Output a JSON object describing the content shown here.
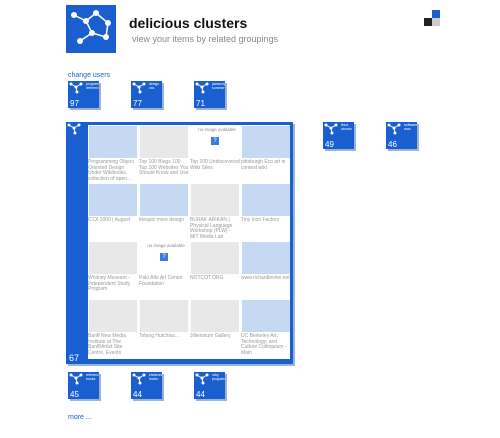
{
  "header": {
    "title": "delicious clusters",
    "subtitle": "view your items by related groupings"
  },
  "links": {
    "change_users": "change users",
    "more": "more ..."
  },
  "top_clusters": [
    {
      "label": "program reference",
      "count": "97"
    },
    {
      "label": "design css",
      "count": "77"
    },
    {
      "label": "javascript summer",
      "count": "71"
    }
  ],
  "side_clusters": [
    {
      "label": "linux ubuntu",
      "count": "49"
    },
    {
      "label": "software mac",
      "count": "46"
    }
  ],
  "bottom_clusters": [
    {
      "label": "reference books",
      "count": "45"
    },
    {
      "label": "electronics howto",
      "count": "44"
    },
    {
      "label": "ruby programming",
      "count": "44"
    }
  ],
  "main_cluster": {
    "count": "67",
    "no_image_text": "no image available",
    "qm_text": "?",
    "items": [
      {
        "thumb": "blank",
        "caption": "Programming Object Oriented Design Under Wikibooks, collection of open..."
      },
      {
        "thumb": "screen",
        "caption": "Top 100 Blogs 100 Top 100 Websites You Should Know and Use"
      },
      {
        "thumb": "none",
        "caption": "Top 100 Undiscovered Web Sites"
      },
      {
        "thumb": "blank",
        "caption": "pittsburgh Eco art in context wiki"
      },
      {
        "thumb": "blank",
        "caption": "ICOI.1000 | August"
      },
      {
        "thumb": "blank",
        "caption": "thequiz more design"
      },
      {
        "thumb": "screen",
        "caption": "BURAK ARIKAN | Physical Language Workshop (PLW) - MIT Media Lab"
      },
      {
        "thumb": "blank",
        "caption": "Tiny Icon Factory"
      },
      {
        "thumb": "screen",
        "caption": "Whitney Museum - Independent Study Program"
      },
      {
        "thumb": "none",
        "caption": "Palo Alto Art Center Foundation"
      },
      {
        "thumb": "screen",
        "caption": "NOTCOT.ORG"
      },
      {
        "thumb": "blank",
        "caption": "www.richardlevine.net"
      },
      {
        "thumb": "screen",
        "caption": "Banff New Media Institute at The Banff/Artist Site Centre, Events"
      },
      {
        "thumb": "screen",
        "caption": "Tofang Hutchiso..."
      },
      {
        "thumb": "screen",
        "caption": "Jilliennium Gallery"
      },
      {
        "thumb": "blank",
        "caption": "UC Berkeley Art, Technology, and Culture Colloquium - Main"
      }
    ]
  }
}
